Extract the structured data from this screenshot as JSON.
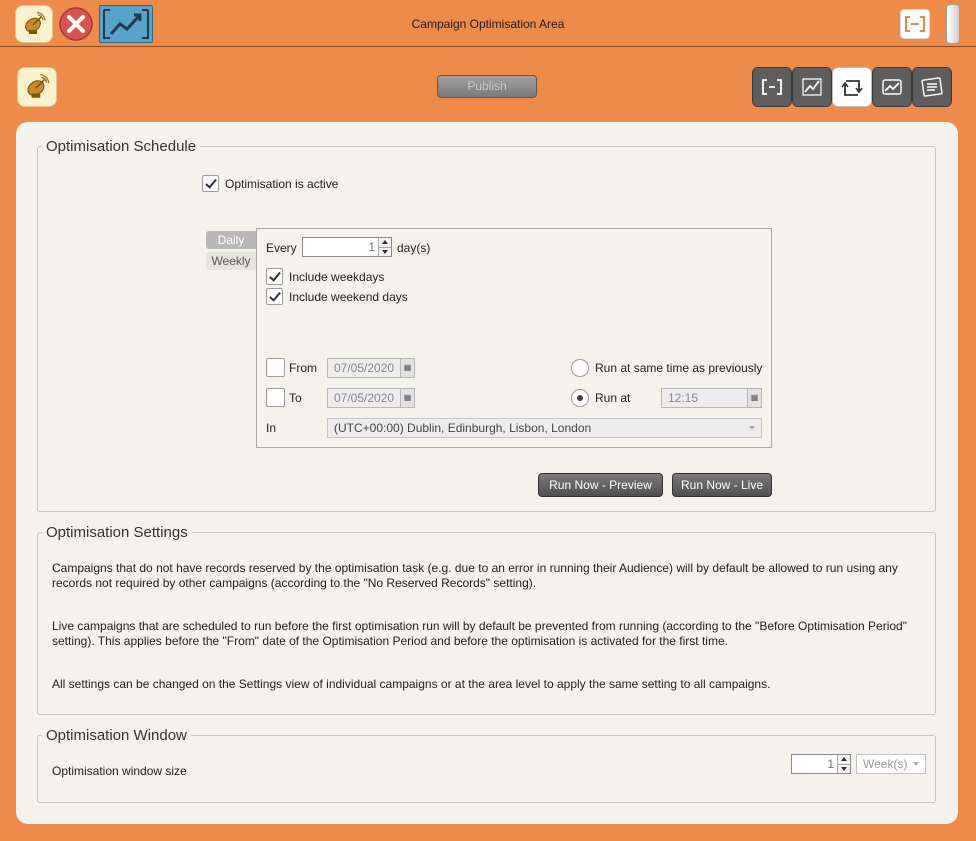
{
  "window": {
    "title": "Campaign Optimisation Area"
  },
  "toolbar": {
    "publish_label": "Publish",
    "view_icons": [
      "frame-icon",
      "chart-line-icon",
      "repeat-icon",
      "trend-icon",
      "list-icon"
    ],
    "active_view": 2
  },
  "schedule": {
    "legend": "Optimisation Schedule",
    "active_label": "Optimisation is active",
    "active_checked": true,
    "tabs": [
      "Daily",
      "Weekly"
    ],
    "every_label": "Every",
    "every_value": "1",
    "every_unit": "day(s)",
    "include_weekdays_label": "Include weekdays",
    "include_weekend_label": "Include weekend days",
    "from_label": "From",
    "from_value": "07/05/2020",
    "to_label": "To",
    "to_value": "07/05/2020",
    "run_same_label": "Run at same time as previously",
    "run_at_label": "Run at",
    "run_at_value": "12:15",
    "tz_label": "In",
    "tz_value": "(UTC+00:00) Dublin, Edinburgh, Lisbon, London",
    "run_preview_label": "Run Now -  Preview",
    "run_live_label": "Run Now - Live"
  },
  "settings": {
    "legend": "Optimisation Settings",
    "p1": "Campaigns that do not have records reserved by the optimisation task (e.g. due to an error in running their Audience) will by default be allowed to run using any records not required by other campaigns (according to the \"No Reserved Records\" setting).",
    "p2": "Live campaigns that are scheduled to run before the first optimisation run will by default be prevented from running (according to the \"Before Optimisation Period\" setting).  This applies before the \"From\" date of the Optimisation Period and before the optimisation is activated for the first time.",
    "p3": "All settings can be changed on the Settings view of individual campaigns or at the area level to apply the same setting to all campaigns."
  },
  "window_group": {
    "legend": "Optimisation Window",
    "size_label": "Optimisation window size",
    "size_value": "1",
    "unit_value": "Week(s)"
  },
  "colors": {
    "accent": "#ee8a4a",
    "panel": "#f5f1ec"
  }
}
